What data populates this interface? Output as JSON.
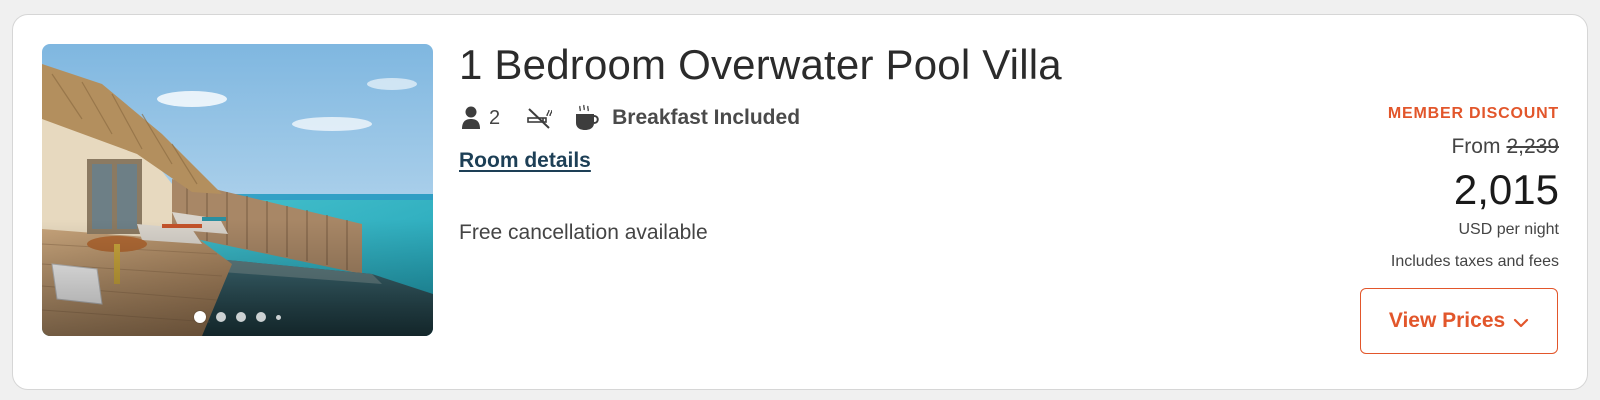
{
  "room": {
    "title": "1 Bedroom Overwater Pool Villa",
    "photo": {
      "alt": "Overwater villa deck with private infinity pool facing turquoise ocean",
      "slide_count": 5,
      "active_slide": 1
    },
    "amenities": {
      "guests_icon": "person-icon",
      "guests": "2",
      "smoking_icon": "no-smoking-icon",
      "breakfast_icon": "coffee-cup-icon",
      "breakfast": "Breakfast Included"
    },
    "details_link": "Room details",
    "cancellation": "Free cancellation available"
  },
  "pricing": {
    "badge": "MEMBER DISCOUNT",
    "from_label": "From",
    "original_price": "2,239",
    "price": "2,015",
    "unit": "USD per night",
    "taxes_note": "Includes taxes and fees",
    "cta_label": "View Prices",
    "cta_icon": "chevron-down-icon"
  },
  "colors": {
    "accent": "#e2562b",
    "link": "#1d3f56",
    "text": "#333333"
  }
}
